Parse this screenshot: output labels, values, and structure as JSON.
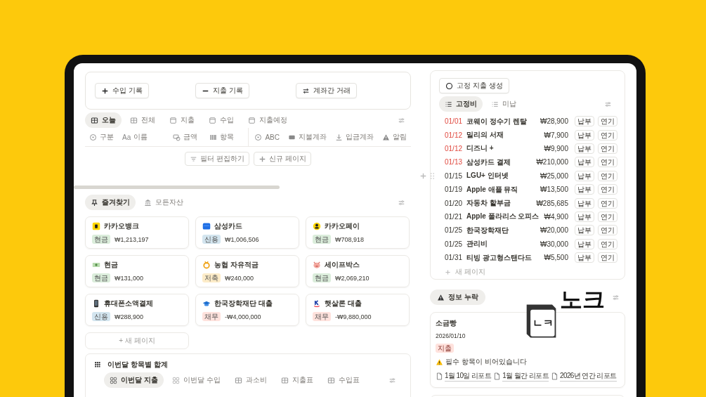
{
  "actions": [
    {
      "label": "수입 기록",
      "kind": "plus"
    },
    {
      "label": "지출 기록",
      "kind": "minus"
    },
    {
      "label": "계좌간 거래",
      "kind": "swap"
    }
  ],
  "views": [
    {
      "label": "오늘",
      "selected": true
    },
    {
      "label": "전체",
      "selected": false
    },
    {
      "label": "지출",
      "selected": false
    },
    {
      "label": "수입",
      "selected": false
    },
    {
      "label": "지출예정",
      "selected": false
    }
  ],
  "properties": [
    {
      "label": "구분"
    },
    {
      "prefix": "Aa",
      "label": "이름"
    },
    {
      "label": "금액"
    },
    {
      "label": "항목"
    },
    {
      "label": "ABC"
    },
    {
      "label": "지불계좌"
    },
    {
      "label": "입금계좌"
    },
    {
      "label": "알림"
    }
  ],
  "filter_buttons": [
    {
      "label": "필터 편집하기",
      "kind": "filter"
    },
    {
      "label": "신규 페이지",
      "kind": "plus"
    }
  ],
  "favorites": {
    "tabs": [
      {
        "label": "즐겨찾기",
        "selected": true
      },
      {
        "label": "모든자산",
        "selected": false
      }
    ],
    "cards": [
      {
        "name": "카카오뱅크",
        "tag": "현금",
        "color": "#dbeddb",
        "amount": "₩1,213,197"
      },
      {
        "name": "삼성카드",
        "tag": "신용",
        "color": "#d3e5ef",
        "amount": "₩1,006,506"
      },
      {
        "name": "카카오페이",
        "tag": "현금",
        "color": "#dbeddb",
        "amount": "₩708,918"
      },
      {
        "name": "현금",
        "tag": "현금",
        "color": "#dbeddb",
        "amount": "₩131,000"
      },
      {
        "name": "농협 자유적금",
        "tag": "저축",
        "color": "#fdecc8",
        "amount": "₩240,000"
      },
      {
        "name": "세이프박스",
        "tag": "현금",
        "color": "#dbeddb",
        "amount": "₩2,069,210"
      },
      {
        "name": "휴대폰소액결제",
        "tag": "신용",
        "color": "#d3e5ef",
        "amount": "₩288,900"
      },
      {
        "name": "한국장학재단 대출",
        "tag": "채무",
        "color": "#ffe2dd",
        "amount": "-₩4,000,000"
      },
      {
        "name": "햇살론 대출",
        "tag": "채무",
        "color": "#ffe2dd",
        "amount": "-₩9,880,000"
      }
    ],
    "new_page": "+ 새 페이지"
  },
  "monthly": {
    "title": "이번달 항목별 합계",
    "tabs": [
      {
        "label": "이번달 지출",
        "selected": true
      },
      {
        "label": "이번달 수입",
        "selected": false
      },
      {
        "label": "과소비",
        "selected": false
      },
      {
        "label": "지출표",
        "selected": false
      },
      {
        "label": "수입표",
        "selected": false
      }
    ]
  },
  "fixed": {
    "create_button": "고정 지출 생성",
    "tabs": [
      {
        "label": "고정비",
        "selected": true
      },
      {
        "label": "미납",
        "selected": false
      }
    ],
    "rows": [
      {
        "date": "01/01",
        "name": "코웨이 정수기 렌탈",
        "amount": "₩28,900",
        "overdue": true,
        "pay": "납부",
        "defer": "연기"
      },
      {
        "date": "01/12",
        "name": "밀리의 서재",
        "amount": "₩7,900",
        "overdue": true,
        "pay": "납부",
        "defer": "연기"
      },
      {
        "date": "01/12",
        "name": "디즈니 +",
        "amount": "₩9,900",
        "overdue": true,
        "pay": "납부",
        "defer": "연기"
      },
      {
        "date": "01/13",
        "name": "삼성카드 결제",
        "amount": "₩210,000",
        "overdue": true,
        "pay": "납부",
        "defer": "연기"
      },
      {
        "date": "01/15",
        "name": "LGU+ 인터넷",
        "amount": "₩25,000",
        "overdue": false,
        "pay": "납부",
        "defer": "연기"
      },
      {
        "date": "01/19",
        "name": "Apple 애플 뮤직",
        "amount": "₩13,500",
        "overdue": false,
        "pay": "납부",
        "defer": "연기"
      },
      {
        "date": "01/20",
        "name": "자동차 할부금",
        "amount": "₩285,685",
        "overdue": false,
        "pay": "납부",
        "defer": "연기"
      },
      {
        "date": "01/21",
        "name": "Apple 폴라리스 오피스",
        "amount": "₩4,900",
        "overdue": false,
        "pay": "납부",
        "defer": "연기"
      },
      {
        "date": "01/25",
        "name": "한국장학재단",
        "amount": "₩20,000",
        "overdue": false,
        "pay": "납부",
        "defer": "연기"
      },
      {
        "date": "01/25",
        "name": "관리비",
        "amount": "₩30,000",
        "overdue": false,
        "pay": "납부",
        "defer": "연기"
      },
      {
        "date": "01/31",
        "name": "티빙 광고형스탠다드",
        "amount": "₩5,500",
        "overdue": false,
        "pay": "납부",
        "defer": "연기"
      }
    ],
    "new_page": "새 페이지"
  },
  "missing": {
    "tab": "정보 누락",
    "card": {
      "title": "소금빵",
      "date": "2026/01/10",
      "tag": "지출",
      "color": "#ffe2dd",
      "warning": "필수 항목이 비어있습니다",
      "links": [
        "1월 10일 리포트",
        "1월 월간 리포트",
        "2026년 연간 리포트"
      ]
    }
  },
  "logo": {
    "mark": "ㄴㅋ",
    "name": "노크"
  }
}
